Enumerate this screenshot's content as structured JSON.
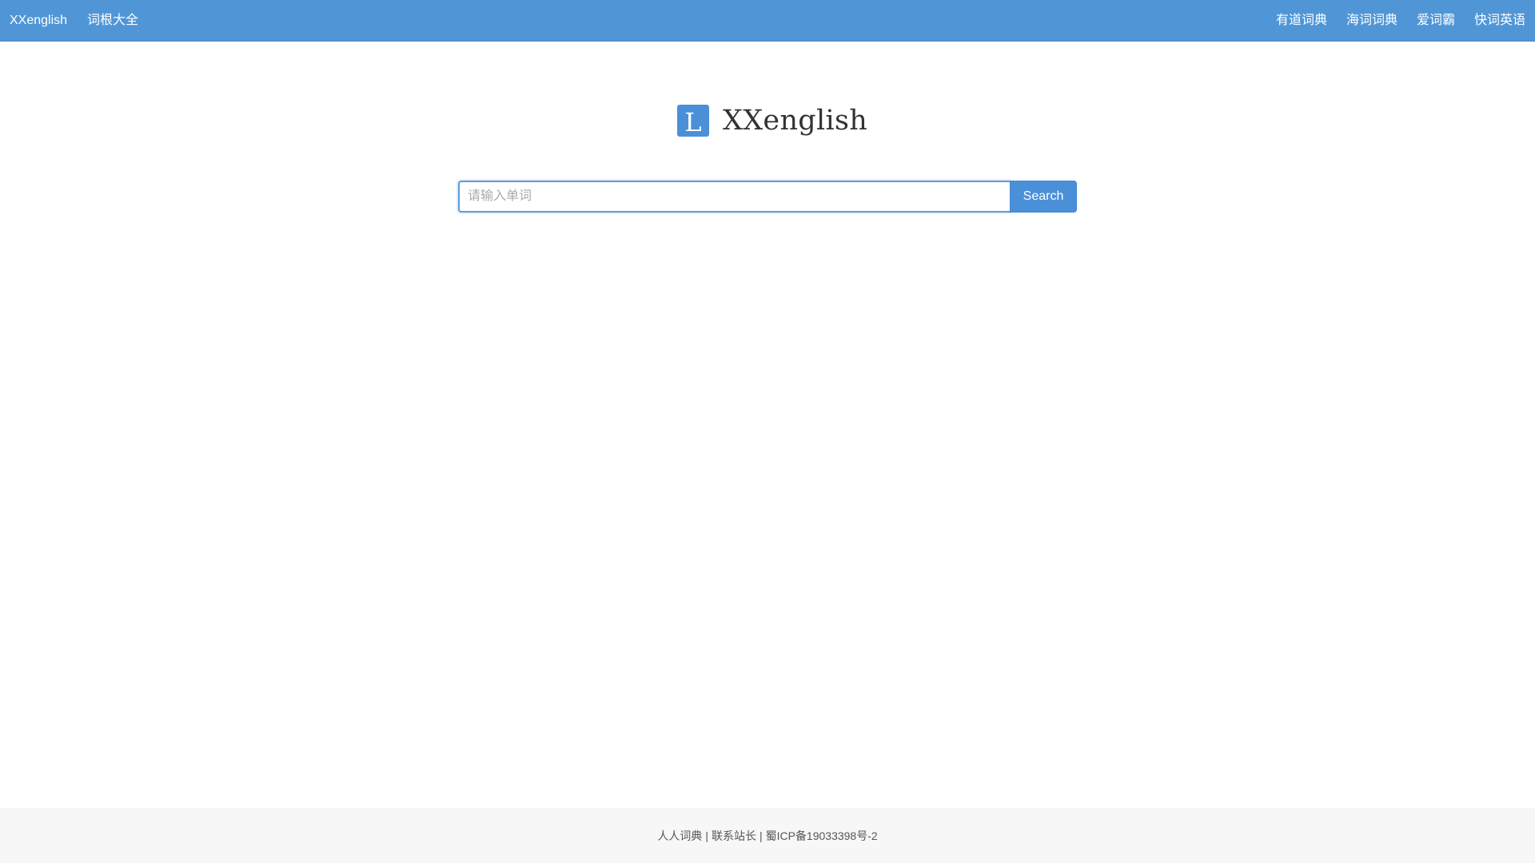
{
  "navbar": {
    "brand": "XXenglish",
    "left_links": [
      "词根大全"
    ],
    "right_links": [
      "有道词典",
      "海词词典",
      "爱词霸",
      "快词英语"
    ],
    "bg_color": "#5096d7"
  },
  "main": {
    "logo_letter": "L",
    "title": "XXenglish",
    "search": {
      "placeholder": "请输入单词",
      "value": "",
      "button_label": "Search"
    }
  },
  "footer": {
    "links": [
      "人人词典",
      "联系站长",
      "蜀ICP备19033398号-2"
    ],
    "separator": "|"
  }
}
